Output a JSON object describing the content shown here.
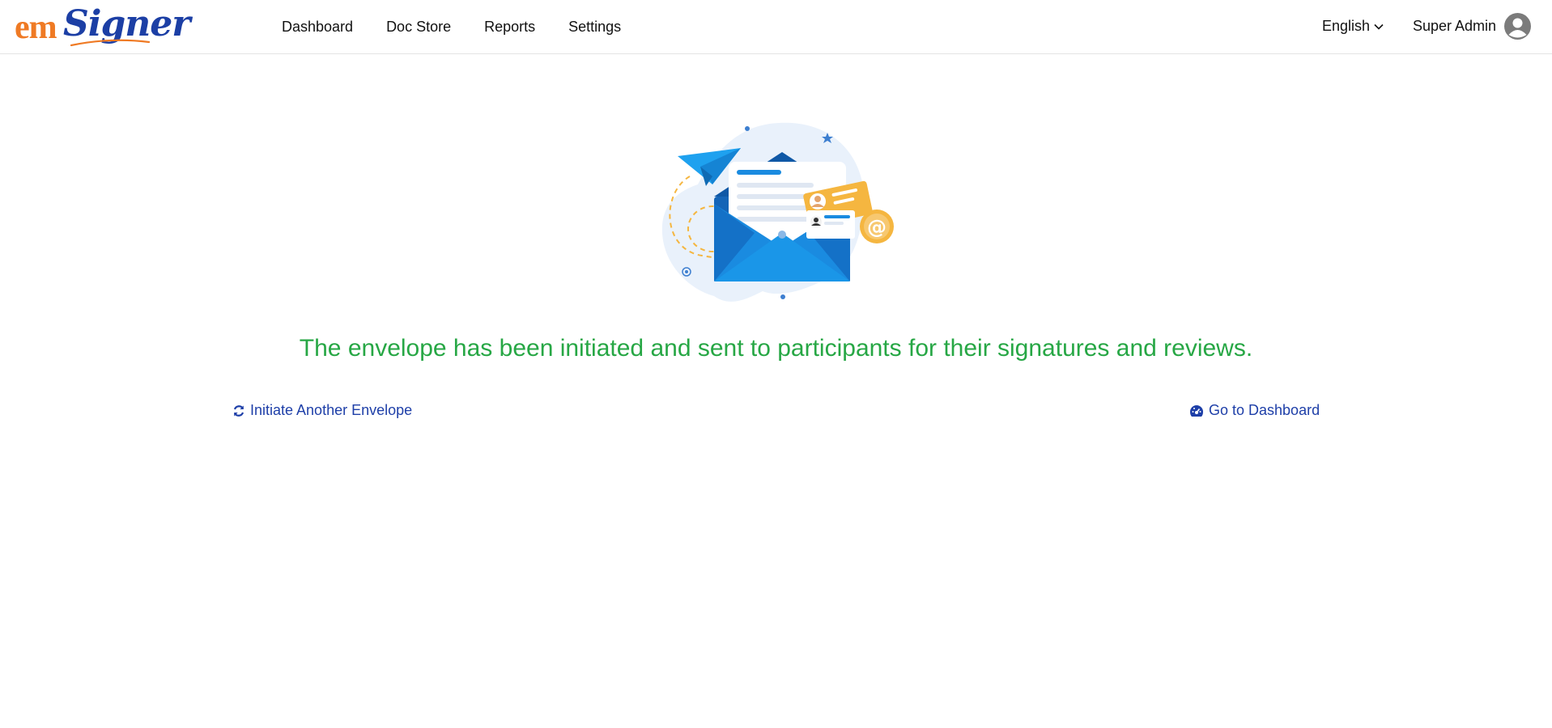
{
  "brand": {
    "logo_part1": "em",
    "logo_part2": "Signer",
    "colors": {
      "orange": "#ef7a24",
      "blue": "#1c3fa5"
    }
  },
  "nav": {
    "items": [
      {
        "label": "Dashboard"
      },
      {
        "label": "Doc Store"
      },
      {
        "label": "Reports"
      },
      {
        "label": "Settings"
      }
    ]
  },
  "header": {
    "language": "English",
    "language_icon": "chevron-down-icon",
    "user_name": "Super Admin",
    "user_icon": "user-avatar-icon"
  },
  "main": {
    "illustration": "envelope-sent-illustration",
    "message": "The envelope has been initiated and sent to participants for their signatures and reviews.",
    "message_color": "#27a745",
    "actions": {
      "initiate_label": "Initiate Another Envelope",
      "initiate_icon": "refresh-icon",
      "dashboard_label": "Go to Dashboard",
      "dashboard_icon": "dashboard-gauge-icon",
      "link_color": "#1e3fa8"
    }
  }
}
